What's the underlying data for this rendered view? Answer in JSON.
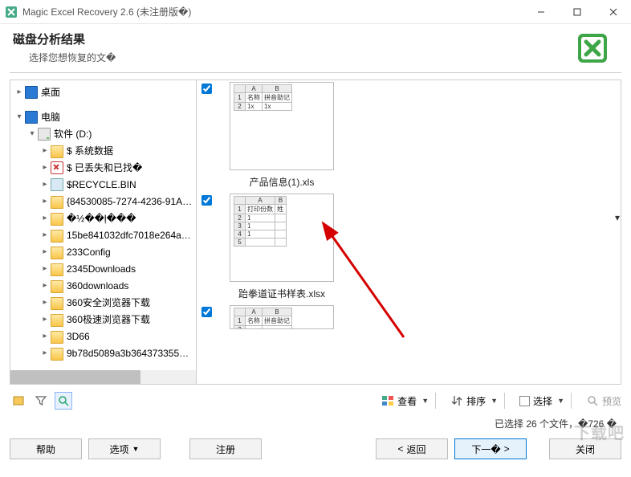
{
  "titlebar": {
    "title": "Magic Excel Recovery 2.6 (未注册版�)"
  },
  "header": {
    "title": "磁盘分析结果",
    "subtitle": "选择您想恢复的文�"
  },
  "tree": {
    "desktop": "桌面",
    "computer": "电脑",
    "drive": "软件 (D:)",
    "items": [
      "$ 系统数据",
      "$ 已丢失和已找�",
      "$RECYCLE.BIN",
      "{84530085-7274-4236-91A…",
      "�½��ļ���",
      "15be841032dfc7018e264a…",
      "233Config",
      "2345Downloads",
      "360downloads",
      "360安全浏览器下载",
      "360极速浏览器下载",
      "3D66",
      "9b78d5089a3b364373355…"
    ]
  },
  "files": [
    {
      "name": "产品信息(1).xls",
      "cols": [
        "A",
        "B"
      ],
      "rows": [
        [
          "1",
          "名称",
          "拼音助记"
        ],
        [
          "2",
          "1x",
          "1x"
        ]
      ]
    },
    {
      "name": "跆拳道证书样表.xlsx",
      "cols": [
        "A",
        "B"
      ],
      "rows": [
        [
          "1",
          "打印份数",
          "姓"
        ],
        [
          "2",
          "1",
          ""
        ],
        [
          "3",
          "1",
          ""
        ],
        [
          "4",
          "1",
          ""
        ],
        [
          "5",
          "",
          ""
        ]
      ]
    },
    {
      "name": "",
      "cols": [
        "A",
        "B"
      ],
      "rows": [
        [
          "1",
          "名称",
          "拼音助记"
        ],
        [
          "2",
          "",
          ""
        ]
      ]
    }
  ],
  "toolbar": {
    "view": "查看",
    "sort": "排序",
    "select": "选择",
    "preview": "预览"
  },
  "status": "已选择 26 个文件，�726 �",
  "buttons": {
    "help": "帮助",
    "options": "选项",
    "register": "注册",
    "back": "返回",
    "next": "下一�",
    "close": "关闭"
  },
  "watermark": "下载吧"
}
